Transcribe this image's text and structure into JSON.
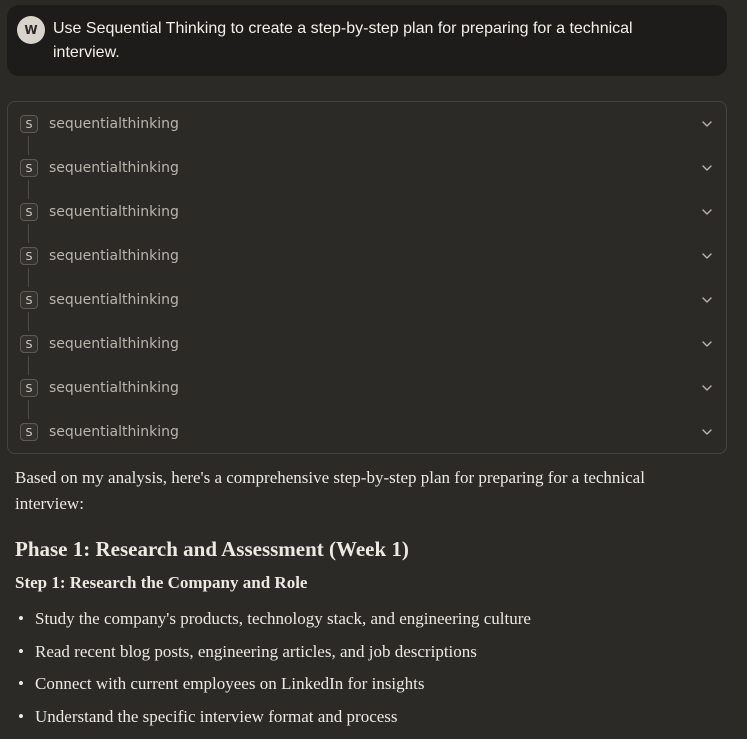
{
  "user_message": {
    "avatar_initial": "W",
    "text": "Use Sequential Thinking to create a step-by-step plan for preparing for a technical interview."
  },
  "tool_calls": [
    {
      "badge": "S",
      "label": "sequentialthinking"
    },
    {
      "badge": "S",
      "label": "sequentialthinking"
    },
    {
      "badge": "S",
      "label": "sequentialthinking"
    },
    {
      "badge": "S",
      "label": "sequentialthinking"
    },
    {
      "badge": "S",
      "label": "sequentialthinking"
    },
    {
      "badge": "S",
      "label": "sequentialthinking"
    },
    {
      "badge": "S",
      "label": "sequentialthinking"
    },
    {
      "badge": "S",
      "label": "sequentialthinking"
    }
  ],
  "response": {
    "intro": "Based on my analysis, here's a comprehensive step-by-step plan for preparing for a technical interview:",
    "phase_heading": "Phase 1: Research and Assessment (Week 1)",
    "step_heading": "Step 1: Research the Company and Role",
    "bullets": [
      "Study the company's products, technology stack, and engineering culture",
      "Read recent blog posts, engineering articles, and job descriptions",
      "Connect with current employees on LinkedIn for insights",
      "Understand the specific interview format and process"
    ]
  }
}
